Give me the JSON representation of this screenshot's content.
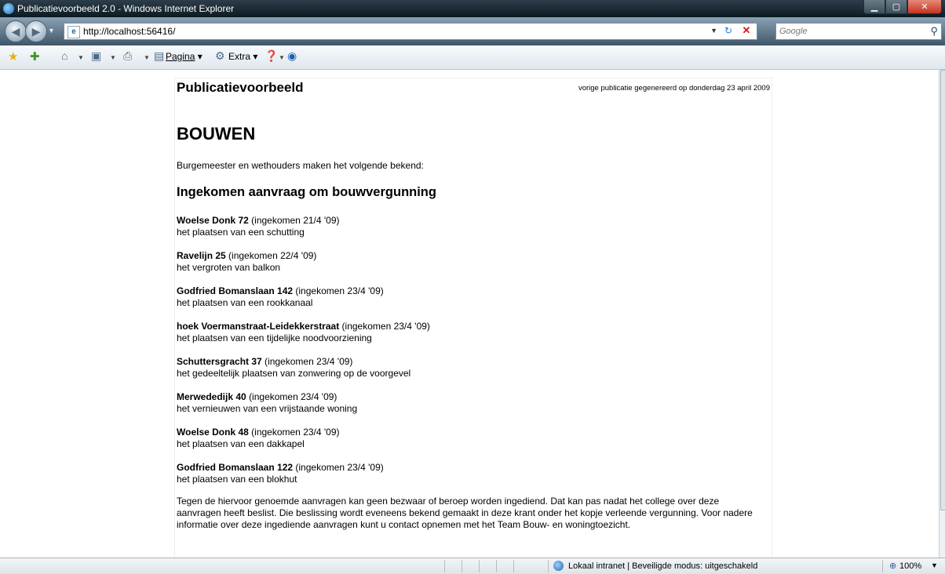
{
  "window": {
    "title": "Publicatievoorbeeld 2.0 - Windows Internet Explorer"
  },
  "toolbar": {
    "url": "http://localhost:56416/",
    "search_placeholder": "Google",
    "pagina_label": "Pagina",
    "extra_label": "Extra"
  },
  "page": {
    "site_title": "Publicatievoorbeeld",
    "generated_note": "vorige publicatie gegenereerd op donderdag 23 april 2009",
    "section_title": "BOUWEN",
    "intro": "Burgemeester en wethouders maken het volgende bekend:",
    "subheading": "Ingekomen aanvraag om bouwvergunning",
    "entries": [
      {
        "address": "Woelse Donk 72",
        "received": "(ingekomen 21/4 '09)",
        "description": "het plaatsen van een schutting"
      },
      {
        "address": "Ravelijn 25",
        "received": "(ingekomen 22/4 '09)",
        "description": "het vergroten van balkon"
      },
      {
        "address": "Godfried Bomanslaan 142",
        "received": "(ingekomen 23/4 '09)",
        "description": "het plaatsen van een rookkanaal"
      },
      {
        "address": "hoek Voermanstraat-Leidekkerstraat",
        "received": "(ingekomen 23/4 '09)",
        "description": "het plaatsen van een tijdelijke noodvoorziening"
      },
      {
        "address": "Schuttersgracht 37",
        "received": "(ingekomen 23/4 '09)",
        "description": "het gedeeltelijk plaatsen van zonwering op de voorgevel"
      },
      {
        "address": "Merwededijk 40",
        "received": "(ingekomen 23/4 '09)",
        "description": "het vernieuwen van een vrijstaande woning"
      },
      {
        "address": "Woelse Donk 48",
        "received": "(ingekomen 23/4 '09)",
        "description": "het plaatsen van een dakkapel"
      },
      {
        "address": "Godfried Bomanslaan 122",
        "received": "(ingekomen 23/4 '09)",
        "description": "het plaatsen van een blokhut"
      }
    ],
    "closing": [
      "Tegen de hiervoor genoemde aanvragen kan geen bezwaar of beroep worden ingediend. Dat kan pas nadat het college over deze",
      "aanvragen heeft beslist. Die beslissing wordt eveneens bekend gemaakt in deze krant onder het kopje verleende vergunning. Voor nadere",
      "informatie over deze ingediende aanvragen kunt u contact opnemen met het Team Bouw- en woningtoezicht."
    ]
  },
  "status": {
    "zone": "Lokaal intranet | Beveiligde modus: uitgeschakeld",
    "zoom": "100%"
  },
  "icons": [
    "ie-icon",
    "back-icon",
    "forward-icon",
    "page-icon",
    "refresh-icon",
    "stop-icon",
    "search-icon",
    "favorites-star-icon",
    "add-favorites-icon",
    "home-icon",
    "feeds-icon",
    "print-icon",
    "page-menu-icon",
    "tools-icon",
    "help-icon",
    "research-icon",
    "globe-icon",
    "zoom-icon"
  ]
}
